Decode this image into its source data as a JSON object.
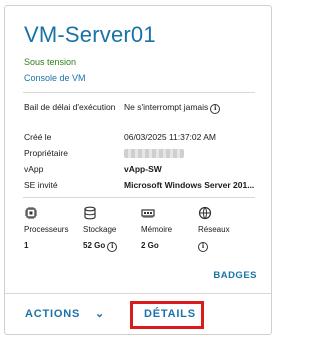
{
  "card": {
    "title": "VM-Server01",
    "status": "Sous tension",
    "console_link": "Console de VM",
    "properties": [
      {
        "label": "Bail de délai d'exécution",
        "value": "Ne s'interrompt jamais",
        "info_icon": "info-icon"
      },
      {
        "label": "Créé le",
        "value": "06/03/2025 11:37:02 AM"
      },
      {
        "label": "Propriétaire",
        "value": "",
        "redacted": true
      },
      {
        "label": "vApp",
        "value": "vApp-SW"
      },
      {
        "label": "SE invité",
        "value": "Microsoft Windows Server 201..."
      }
    ],
    "resources": [
      {
        "icon": "processor-icon",
        "label": "Processeurs",
        "value": "1"
      },
      {
        "icon": "storage-icon",
        "label": "Stockage",
        "value": "52 Go",
        "info_icon": "info-icon"
      },
      {
        "icon": "memory-icon",
        "label": "Mémoire",
        "value": "2 Go"
      },
      {
        "icon": "network-icon",
        "label": "Réseaux",
        "value": "",
        "info_icon": "info-icon"
      }
    ],
    "badges_link": "BADGES",
    "footer": {
      "actions_label": "ACTIONS",
      "details_label": "DÉTAILS"
    }
  },
  "colors": {
    "link": "#1a73a8",
    "status_ok": "#2e7d1a",
    "highlight": "#d81c1c"
  }
}
